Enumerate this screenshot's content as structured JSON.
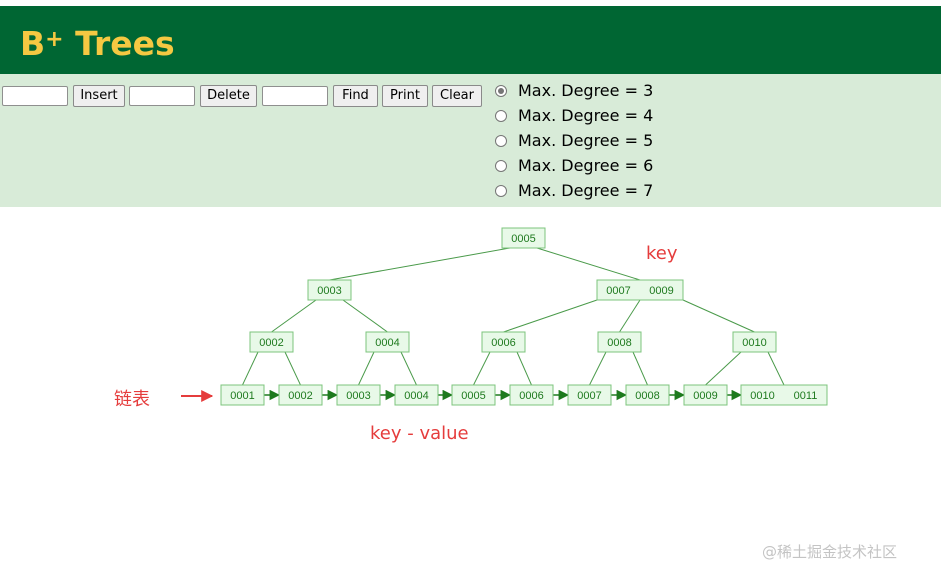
{
  "header": {
    "title_main": "B",
    "title_sup": "+",
    "title_rest": " Trees",
    "bg_color": "#006633",
    "title_color": "#f5c842"
  },
  "toolbar": {
    "insert_value": "",
    "insert_label": "Insert",
    "delete_value": "",
    "delete_label": "Delete",
    "find_value": "",
    "find_label": "Find",
    "print_label": "Print",
    "clear_label": "Clear"
  },
  "degree_options": [
    {
      "label": "Max. Degree = 3",
      "checked": true
    },
    {
      "label": "Max. Degree = 4",
      "checked": false
    },
    {
      "label": "Max. Degree = 5",
      "checked": false
    },
    {
      "label": "Max. Degree = 6",
      "checked": false
    },
    {
      "label": "Max. Degree = 7",
      "checked": false
    }
  ],
  "tree": {
    "root": [
      "0005"
    ],
    "level1": [
      [
        "0003"
      ],
      [
        "0007",
        "0009"
      ]
    ],
    "level2": [
      [
        "0002"
      ],
      [
        "0004"
      ],
      [
        "0006"
      ],
      [
        "0008"
      ],
      [
        "0010"
      ]
    ],
    "leaves": [
      [
        "0001"
      ],
      [
        "0002"
      ],
      [
        "0003"
      ],
      [
        "0004"
      ],
      [
        "0005"
      ],
      [
        "0006"
      ],
      [
        "0007"
      ],
      [
        "0008"
      ],
      [
        "0009"
      ],
      [
        "0010",
        "0011"
      ]
    ]
  },
  "annotations": {
    "key": "key",
    "linked_list": "链表",
    "key_value": "key - value"
  },
  "watermark": "@稀土掘金技术社区",
  "colors": {
    "controls_bg": "#d8ebd8",
    "node_fill": "#e8f9e8",
    "node_stroke": "#7cc47c",
    "edge": "#4a9a4a",
    "annotation": "#e53c3c"
  }
}
